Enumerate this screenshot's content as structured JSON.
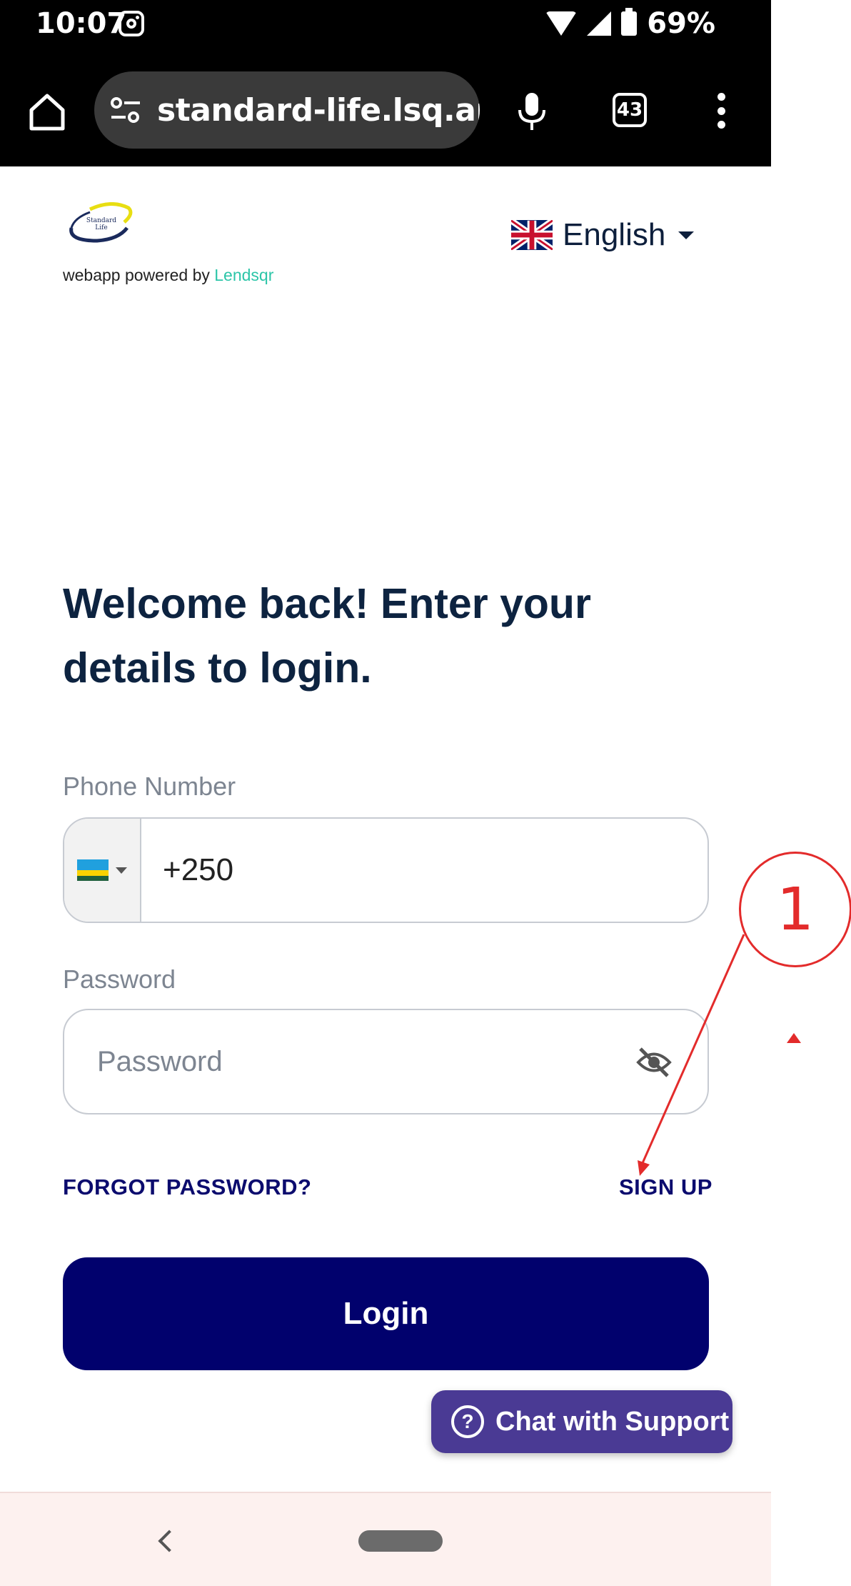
{
  "status_bar": {
    "time": "10:07",
    "battery": "69%",
    "icons": [
      "instagram-icon",
      "wifi-icon",
      "signal-icon",
      "battery-icon"
    ]
  },
  "browser": {
    "url": "standard-life.lsq.app",
    "url_trail": "/",
    "tab_count": "43",
    "icons": [
      "home-icon",
      "tune-icon",
      "mic-icon",
      "tabs-icon",
      "more-vert-icon"
    ]
  },
  "header": {
    "logo_text": "Standard Life",
    "powered_by": "webapp powered by ",
    "powered_brand": "Lendsqr",
    "language": "English"
  },
  "form": {
    "heading": "Welcome back! Enter your details to login.",
    "phone_label": "Phone Number",
    "phone_value": "+250",
    "password_label": "Password",
    "password_placeholder": "Password",
    "forgot_password": "FORGOT PASSWORD?",
    "sign_up": "SIGN UP",
    "login_button": "Login"
  },
  "support": {
    "chat_label": "Chat with Support"
  },
  "annotation": {
    "number": "1"
  },
  "colors": {
    "primary": "#01016d",
    "heading": "#0d2340",
    "brand_accent": "#2cc5a8",
    "chat_button": "#4a3a94",
    "annotation": "#e32b2b"
  }
}
